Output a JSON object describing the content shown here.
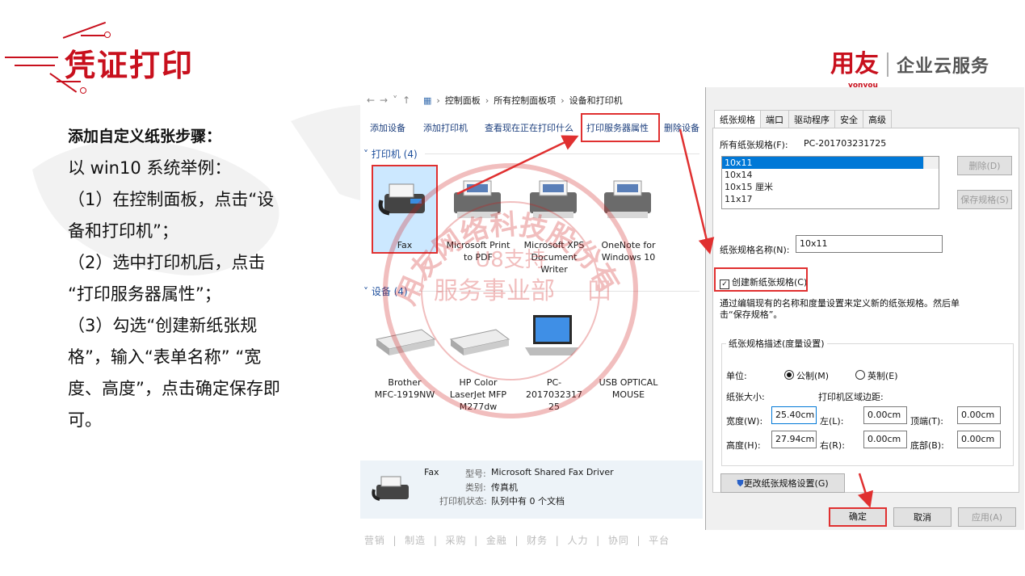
{
  "title": "凭证打印",
  "logo": {
    "main": "用友",
    "sub": "yonyou",
    "text": "企业云服务"
  },
  "steps": {
    "heading": "添加自定义纸张步骤：",
    "lines": [
      "以 win10 系统举例：",
      "（1）在控制面板，点击“设",
      "备和打印机”；",
      "（2）选中打印机后，点击",
      "“打印服务器属性”；",
      "（3）勾选“创建新纸张规",
      "格”，输入“表单名称” “宽",
      "度、高度”，点击确定保存即",
      "可。"
    ]
  },
  "explorer": {
    "breadcrumb": [
      "控制面板",
      "所有控制面板项",
      "设备和打印机"
    ],
    "toolbar": [
      "添加设备",
      "添加打印机",
      "查看现在正在打印什么",
      "打印服务器属性",
      "删除设备"
    ],
    "printers_group": "打印机 (4)",
    "devices_group": "设备 (4)",
    "printers": [
      {
        "lines": [
          "Fax"
        ]
      },
      {
        "lines": [
          "Microsoft Print",
          "to PDF"
        ]
      },
      {
        "lines": [
          "Microsoft XPS",
          "Document",
          "Writer"
        ]
      },
      {
        "lines": [
          "OneNote for",
          "Windows 10"
        ]
      }
    ],
    "devices": [
      {
        "lines": [
          "Brother",
          "MFC-1919NW"
        ]
      },
      {
        "lines": [
          "HP Color",
          "LaserJet MFP",
          "M277dw"
        ]
      },
      {
        "lines": [
          "PC-2017032317",
          "25"
        ]
      },
      {
        "lines": [
          "USB OPTICAL",
          "MOUSE"
        ]
      }
    ],
    "status": {
      "name": "Fax",
      "model_label": "型号:",
      "model_value": "Microsoft Shared Fax Driver",
      "category_label": "类别:",
      "category_value": "传真机",
      "state_label": "打印机状态:",
      "state_value": "队列中有 0 个文档"
    }
  },
  "stamp": {
    "arc_text": "用友网络科技股份有限公司",
    "line1": "U8支持",
    "line2": "服务事业部",
    "line3": "凹"
  },
  "dialog": {
    "tabs": [
      "纸张规格",
      "端口",
      "驱动程序",
      "安全",
      "高级"
    ],
    "all_forms_label": "所有纸张规格(F):",
    "all_forms_value": "PC-201703231725",
    "forms": [
      "10x11",
      "10x14",
      "10x15 厘米",
      "11x17"
    ],
    "delete_btn": "删除(D)",
    "save_btn": "保存规格(S)",
    "form_name_label": "纸张规格名称(N):",
    "form_name_value": "10x11",
    "create_checkbox": "创建新纸张规格(C)",
    "desc": [
      "通过编辑现有的名称和度量设置来定义新的纸张规格。然后单",
      "击“保存规格”。"
    ],
    "fieldset_title": "纸张规格描述(度量设置)",
    "unit_label": "单位:",
    "metric": "公制(M)",
    "imperial": "英制(E)",
    "paper_size": "纸张大小:",
    "margins": "打印机区域边距:",
    "width_label": "宽度(W):",
    "width_value": "25.40cm",
    "height_label": "高度(H):",
    "height_value": "27.94cm",
    "left_label": "左(L):",
    "left_value": "0.00cm",
    "right_label": "右(R):",
    "right_value": "0.00cm",
    "top_label": "顶端(T):",
    "top_value": "0.00cm",
    "bottom_label": "底部(B):",
    "bottom_value": "0.00cm",
    "change_btn": "更改纸张规格设置(G)",
    "ok": "确定",
    "cancel": "取消",
    "apply": "应用(A)"
  },
  "footer": [
    "营销",
    "制造",
    "采购",
    "金融",
    "财务",
    "人力",
    "协同",
    "平台"
  ],
  "colors": {
    "brand_red": "#c8101d",
    "highlight": "#e03030",
    "select_blue": "#0078d7"
  }
}
